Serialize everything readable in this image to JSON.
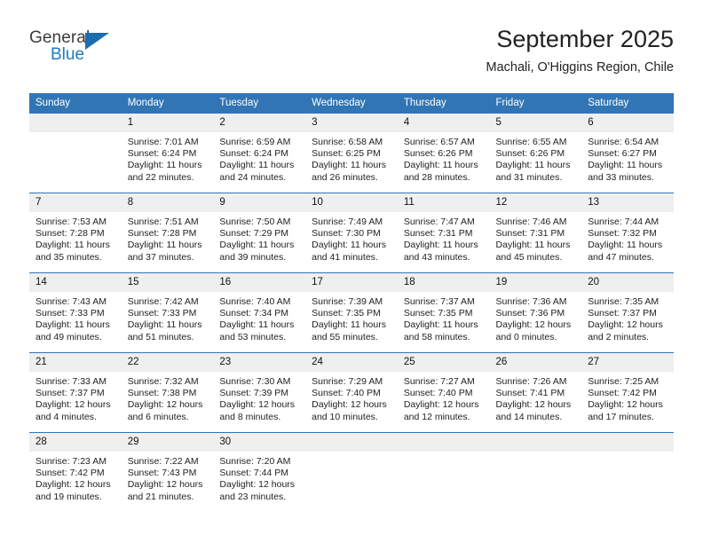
{
  "brand": {
    "name_top": "General",
    "name_bottom": "Blue",
    "flag_icon": "triangle-flag-icon",
    "accent_color": "#1b6cb0"
  },
  "header": {
    "title": "September 2025",
    "subtitle": "Machali, O'Higgins Region, Chile"
  },
  "theme": {
    "header_blue": "#3175b5",
    "daynum_gray": "#efefef"
  },
  "calendar": {
    "weekday_headers": [
      "Sunday",
      "Monday",
      "Tuesday",
      "Wednesday",
      "Thursday",
      "Friday",
      "Saturday"
    ],
    "weeks": [
      [
        {
          "day": "",
          "blank": true,
          "sunrise": "",
          "sunset": "",
          "daylight_line1": "",
          "daylight_line2": ""
        },
        {
          "day": "1",
          "blank": false,
          "sunrise": "Sunrise: 7:01 AM",
          "sunset": "Sunset: 6:24 PM",
          "daylight_line1": "Daylight: 11 hours",
          "daylight_line2": "and 22 minutes."
        },
        {
          "day": "2",
          "blank": false,
          "sunrise": "Sunrise: 6:59 AM",
          "sunset": "Sunset: 6:24 PM",
          "daylight_line1": "Daylight: 11 hours",
          "daylight_line2": "and 24 minutes."
        },
        {
          "day": "3",
          "blank": false,
          "sunrise": "Sunrise: 6:58 AM",
          "sunset": "Sunset: 6:25 PM",
          "daylight_line1": "Daylight: 11 hours",
          "daylight_line2": "and 26 minutes."
        },
        {
          "day": "4",
          "blank": false,
          "sunrise": "Sunrise: 6:57 AM",
          "sunset": "Sunset: 6:26 PM",
          "daylight_line1": "Daylight: 11 hours",
          "daylight_line2": "and 28 minutes."
        },
        {
          "day": "5",
          "blank": false,
          "sunrise": "Sunrise: 6:55 AM",
          "sunset": "Sunset: 6:26 PM",
          "daylight_line1": "Daylight: 11 hours",
          "daylight_line2": "and 31 minutes."
        },
        {
          "day": "6",
          "blank": false,
          "sunrise": "Sunrise: 6:54 AM",
          "sunset": "Sunset: 6:27 PM",
          "daylight_line1": "Daylight: 11 hours",
          "daylight_line2": "and 33 minutes."
        }
      ],
      [
        {
          "day": "7",
          "blank": false,
          "sunrise": "Sunrise: 7:53 AM",
          "sunset": "Sunset: 7:28 PM",
          "daylight_line1": "Daylight: 11 hours",
          "daylight_line2": "and 35 minutes."
        },
        {
          "day": "8",
          "blank": false,
          "sunrise": "Sunrise: 7:51 AM",
          "sunset": "Sunset: 7:28 PM",
          "daylight_line1": "Daylight: 11 hours",
          "daylight_line2": "and 37 minutes."
        },
        {
          "day": "9",
          "blank": false,
          "sunrise": "Sunrise: 7:50 AM",
          "sunset": "Sunset: 7:29 PM",
          "daylight_line1": "Daylight: 11 hours",
          "daylight_line2": "and 39 minutes."
        },
        {
          "day": "10",
          "blank": false,
          "sunrise": "Sunrise: 7:49 AM",
          "sunset": "Sunset: 7:30 PM",
          "daylight_line1": "Daylight: 11 hours",
          "daylight_line2": "and 41 minutes."
        },
        {
          "day": "11",
          "blank": false,
          "sunrise": "Sunrise: 7:47 AM",
          "sunset": "Sunset: 7:31 PM",
          "daylight_line1": "Daylight: 11 hours",
          "daylight_line2": "and 43 minutes."
        },
        {
          "day": "12",
          "blank": false,
          "sunrise": "Sunrise: 7:46 AM",
          "sunset": "Sunset: 7:31 PM",
          "daylight_line1": "Daylight: 11 hours",
          "daylight_line2": "and 45 minutes."
        },
        {
          "day": "13",
          "blank": false,
          "sunrise": "Sunrise: 7:44 AM",
          "sunset": "Sunset: 7:32 PM",
          "daylight_line1": "Daylight: 11 hours",
          "daylight_line2": "and 47 minutes."
        }
      ],
      [
        {
          "day": "14",
          "blank": false,
          "sunrise": "Sunrise: 7:43 AM",
          "sunset": "Sunset: 7:33 PM",
          "daylight_line1": "Daylight: 11 hours",
          "daylight_line2": "and 49 minutes."
        },
        {
          "day": "15",
          "blank": false,
          "sunrise": "Sunrise: 7:42 AM",
          "sunset": "Sunset: 7:33 PM",
          "daylight_line1": "Daylight: 11 hours",
          "daylight_line2": "and 51 minutes."
        },
        {
          "day": "16",
          "blank": false,
          "sunrise": "Sunrise: 7:40 AM",
          "sunset": "Sunset: 7:34 PM",
          "daylight_line1": "Daylight: 11 hours",
          "daylight_line2": "and 53 minutes."
        },
        {
          "day": "17",
          "blank": false,
          "sunrise": "Sunrise: 7:39 AM",
          "sunset": "Sunset: 7:35 PM",
          "daylight_line1": "Daylight: 11 hours",
          "daylight_line2": "and 55 minutes."
        },
        {
          "day": "18",
          "blank": false,
          "sunrise": "Sunrise: 7:37 AM",
          "sunset": "Sunset: 7:35 PM",
          "daylight_line1": "Daylight: 11 hours",
          "daylight_line2": "and 58 minutes."
        },
        {
          "day": "19",
          "blank": false,
          "sunrise": "Sunrise: 7:36 AM",
          "sunset": "Sunset: 7:36 PM",
          "daylight_line1": "Daylight: 12 hours",
          "daylight_line2": "and 0 minutes."
        },
        {
          "day": "20",
          "blank": false,
          "sunrise": "Sunrise: 7:35 AM",
          "sunset": "Sunset: 7:37 PM",
          "daylight_line1": "Daylight: 12 hours",
          "daylight_line2": "and 2 minutes."
        }
      ],
      [
        {
          "day": "21",
          "blank": false,
          "sunrise": "Sunrise: 7:33 AM",
          "sunset": "Sunset: 7:37 PM",
          "daylight_line1": "Daylight: 12 hours",
          "daylight_line2": "and 4 minutes."
        },
        {
          "day": "22",
          "blank": false,
          "sunrise": "Sunrise: 7:32 AM",
          "sunset": "Sunset: 7:38 PM",
          "daylight_line1": "Daylight: 12 hours",
          "daylight_line2": "and 6 minutes."
        },
        {
          "day": "23",
          "blank": false,
          "sunrise": "Sunrise: 7:30 AM",
          "sunset": "Sunset: 7:39 PM",
          "daylight_line1": "Daylight: 12 hours",
          "daylight_line2": "and 8 minutes."
        },
        {
          "day": "24",
          "blank": false,
          "sunrise": "Sunrise: 7:29 AM",
          "sunset": "Sunset: 7:40 PM",
          "daylight_line1": "Daylight: 12 hours",
          "daylight_line2": "and 10 minutes."
        },
        {
          "day": "25",
          "blank": false,
          "sunrise": "Sunrise: 7:27 AM",
          "sunset": "Sunset: 7:40 PM",
          "daylight_line1": "Daylight: 12 hours",
          "daylight_line2": "and 12 minutes."
        },
        {
          "day": "26",
          "blank": false,
          "sunrise": "Sunrise: 7:26 AM",
          "sunset": "Sunset: 7:41 PM",
          "daylight_line1": "Daylight: 12 hours",
          "daylight_line2": "and 14 minutes."
        },
        {
          "day": "27",
          "blank": false,
          "sunrise": "Sunrise: 7:25 AM",
          "sunset": "Sunset: 7:42 PM",
          "daylight_line1": "Daylight: 12 hours",
          "daylight_line2": "and 17 minutes."
        }
      ],
      [
        {
          "day": "28",
          "blank": false,
          "sunrise": "Sunrise: 7:23 AM",
          "sunset": "Sunset: 7:42 PM",
          "daylight_line1": "Daylight: 12 hours",
          "daylight_line2": "and 19 minutes."
        },
        {
          "day": "29",
          "blank": false,
          "sunrise": "Sunrise: 7:22 AM",
          "sunset": "Sunset: 7:43 PM",
          "daylight_line1": "Daylight: 12 hours",
          "daylight_line2": "and 21 minutes."
        },
        {
          "day": "30",
          "blank": false,
          "sunrise": "Sunrise: 7:20 AM",
          "sunset": "Sunset: 7:44 PM",
          "daylight_line1": "Daylight: 12 hours",
          "daylight_line2": "and 23 minutes."
        },
        {
          "day": "",
          "blank": true,
          "sunrise": "",
          "sunset": "",
          "daylight_line1": "",
          "daylight_line2": ""
        },
        {
          "day": "",
          "blank": true,
          "sunrise": "",
          "sunset": "",
          "daylight_line1": "",
          "daylight_line2": ""
        },
        {
          "day": "",
          "blank": true,
          "sunrise": "",
          "sunset": "",
          "daylight_line1": "",
          "daylight_line2": ""
        },
        {
          "day": "",
          "blank": true,
          "sunrise": "",
          "sunset": "",
          "daylight_line1": "",
          "daylight_line2": ""
        }
      ]
    ]
  }
}
